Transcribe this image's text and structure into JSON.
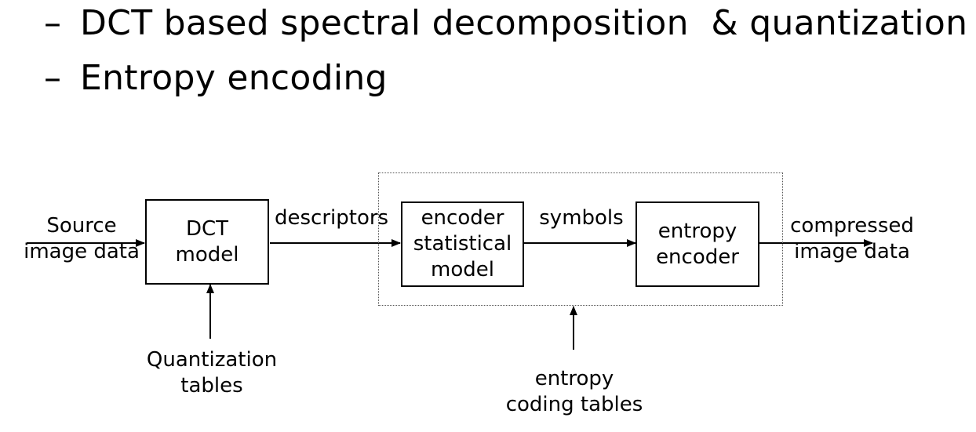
{
  "bullets": [
    {
      "dash": "–",
      "text": "DCT based spectral decomposition  & quantization"
    },
    {
      "dash": "–",
      "text": "Entropy encoding"
    }
  ],
  "diagram": {
    "source_label": [
      "Source",
      "image data"
    ],
    "dct_box": [
      "DCT",
      "model"
    ],
    "descriptors_label": "descriptors",
    "encoder_box": [
      "encoder",
      "statistical",
      "model"
    ],
    "symbols_label": "symbols",
    "entropy_box": [
      "entropy",
      "encoder"
    ],
    "compressed_label": [
      "compressed",
      "image data"
    ],
    "quantization_label": [
      "Quantization",
      "tables"
    ],
    "coding_tables_label": [
      "entropy",
      "coding tables"
    ]
  }
}
